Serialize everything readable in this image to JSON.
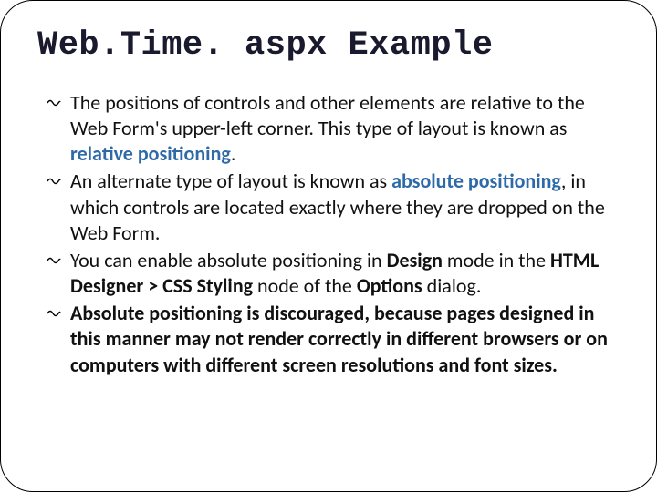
{
  "title": "Web.Time. aspx Example",
  "bullets": [
    {
      "pre": "The positions of controls and other elements are relative to the Web Form's upper-left corner. This type of layout is known as ",
      "term": "relative positioning",
      "post": "."
    },
    {
      "pre": "An alternate type of layout is known as ",
      "term": "absolute positioning",
      "post": ", in which controls are located exactly where they are dropped on the Web Form."
    },
    {
      "text_parts": [
        {
          "t": "You can enable absolute positioning in ",
          "b": false
        },
        {
          "t": "Design",
          "b": true
        },
        {
          "t": " mode in the ",
          "b": false
        },
        {
          "t": "HTML Designer > CSS Styling",
          "b": true
        },
        {
          "t": " node of the ",
          "b": false
        },
        {
          "t": "Options",
          "b": true
        },
        {
          "t": " dialog.",
          "b": false
        }
      ]
    },
    {
      "bold_text": "Absolute positioning is discouraged, because pages designed in this manner may not render correctly in different browsers or on computers with different screen resolutions and font sizes."
    }
  ]
}
